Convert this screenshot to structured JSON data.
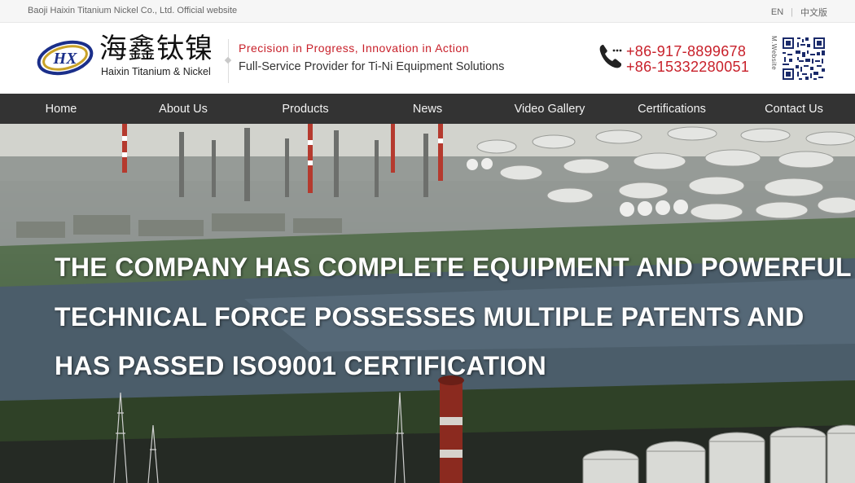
{
  "topbar": {
    "company": "Baoji Haixin Titanium Nickel Co., Ltd. Official website",
    "lang_en": "EN",
    "lang_separator": "|",
    "lang_cn": "中文版"
  },
  "header": {
    "logo_letters": "HX",
    "logo_cn": "海鑫钛镍",
    "logo_en": "Haixin Titanium & Nickel",
    "slogan_primary": "Precision in Progress, Innovation in Action",
    "slogan_secondary": "Full-Service Provider for Ti-Ni Equipment Solutions",
    "phones": [
      "+86-917-8899678",
      "+86-15332280051"
    ],
    "mobile_site_label": "M.Website",
    "icons": [
      "phone-icon",
      "qr-code"
    ]
  },
  "nav": {
    "items": [
      "Home",
      "About Us",
      "Products",
      "News",
      "Video Gallery",
      "Certifications",
      "Contact Us"
    ]
  },
  "hero": {
    "headline_lines": [
      "THE COMPANY HAS COMPLETE EQUIPMENT AND POWERFUL",
      "TECHNICAL FORCE POSSESSES MULTIPLE PATENTS AND",
      "HAS PASSED ISO9001 CERTIFICATION"
    ]
  },
  "colors": {
    "accent_red": "#c8202a",
    "nav_bg": "#333333",
    "logo_blue": "#1b2f8a",
    "logo_gold": "#c9a227"
  }
}
